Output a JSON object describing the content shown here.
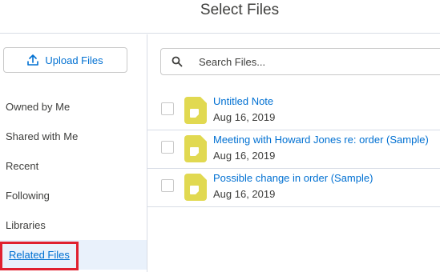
{
  "header": {
    "title": "Select Files"
  },
  "sidebar": {
    "upload_label": "Upload Files",
    "items": [
      {
        "label": "Owned by Me"
      },
      {
        "label": "Shared with Me"
      },
      {
        "label": "Recent"
      },
      {
        "label": "Following"
      },
      {
        "label": "Libraries"
      },
      {
        "label": "Related Files",
        "active": true
      }
    ]
  },
  "search": {
    "placeholder": "Search Files...",
    "value": ""
  },
  "files": [
    {
      "title": "Untitled Note",
      "date": "Aug 16, 2019",
      "icon": "note-file-icon"
    },
    {
      "title": "Meeting with Howard Jones re: order (Sample)",
      "date": "Aug 16, 2019",
      "icon": "note-file-icon"
    },
    {
      "title": "Possible change in order (Sample)",
      "date": "Aug 16, 2019",
      "icon": "note-file-icon"
    }
  ],
  "colors": {
    "accent": "#0070d2",
    "note_icon": "#e1d951",
    "highlight": "#e0202f",
    "active_bg": "#e9f1fb"
  }
}
